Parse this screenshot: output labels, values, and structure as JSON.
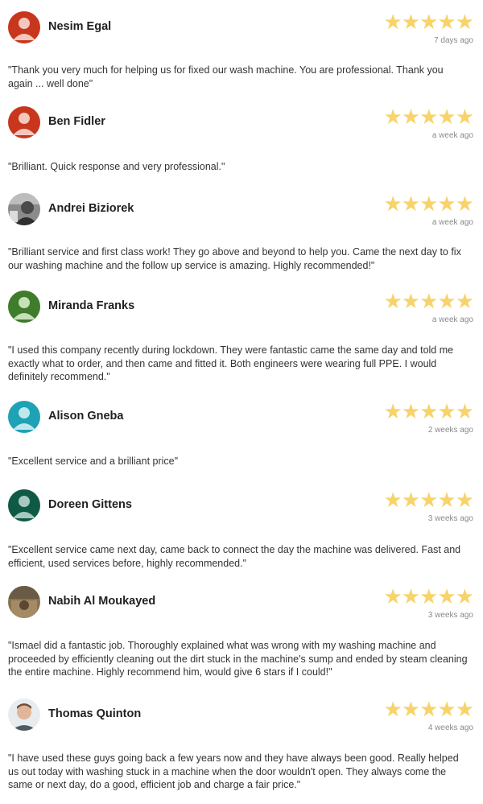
{
  "reviews": [
    {
      "name": "Nesim Egal",
      "time": "7 days ago",
      "stars": "★★★★★",
      "avatar": "red",
      "text": "\"Thank you very much for helping us for fixed our wash machine. You are professional. Thank you again ... well done\""
    },
    {
      "name": "Ben Fidler",
      "time": "a week ago",
      "stars": "★★★★★",
      "avatar": "red",
      "text": "\"Brilliant. Quick response and very professional.\""
    },
    {
      "name": "Andrei Biziorek",
      "time": "a week ago",
      "stars": "★★★★★",
      "avatar": "photo-gray",
      "text": "\"Brilliant service and first class work! They go above and beyond to help you. Came the next day to fix our washing machine and the follow up service is amazing. Highly recommended!\""
    },
    {
      "name": "Miranda Franks",
      "time": "a week ago",
      "stars": "★★★★★",
      "avatar": "green",
      "text": "\"I used this company recently during lockdown. They were fantastic came the same day and told me exactly what to order, and then came and fitted it. Both engineers were wearing full PPE. I would definitely recommend.\""
    },
    {
      "name": "Alison Gneba",
      "time": "2 weeks ago",
      "stars": "★★★★★",
      "avatar": "teal",
      "text": "\"Excellent service and a brilliant price\""
    },
    {
      "name": "Doreen Gittens",
      "time": "3 weeks ago",
      "stars": "★★★★★",
      "avatar": "dark-green",
      "text": "\"Excellent service came next day, came back to connect the day the machine was delivered. Fast and efficient, used services before, highly recommended.\""
    },
    {
      "name": "Nabih Al Moukayed",
      "time": "3 weeks ago",
      "stars": "★★★★★",
      "avatar": "photo-brown",
      "text": "\"Ismael did a fantastic job. Thoroughly explained what was wrong with my washing machine and proceeded by efficiently cleaning out the dirt stuck in the machine's sump and ended by steam cleaning the entire machine. Highly recommend him, would give 6 stars if I could!\""
    },
    {
      "name": "Thomas Quinton",
      "time": "4 weeks ago",
      "stars": "★★★★★",
      "avatar": "photo-face",
      "text": "\"I have used these guys going back a few years now and they have always been good. Really helped us out today with washing stuck in a machine when the door wouldn't open. They always come the same or next day, do a good, efficient job and charge a fair price.\""
    }
  ],
  "colors": {
    "star": "#f7d36a",
    "red": "#c8361d",
    "green": "#3f7c2b",
    "teal": "#1ea2b5",
    "dark-green": "#0f5a46"
  }
}
